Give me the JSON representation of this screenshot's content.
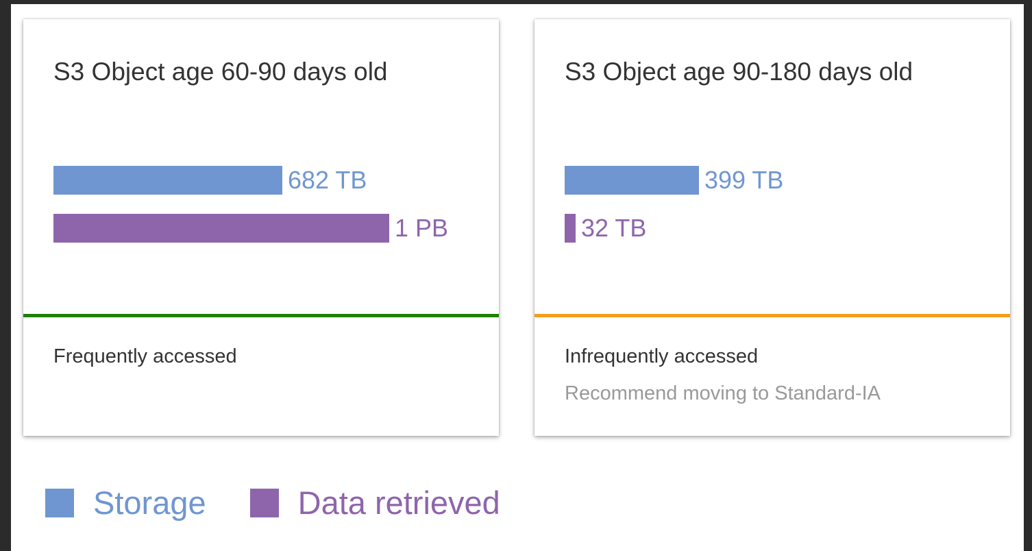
{
  "colors": {
    "storage": "#6f96d1",
    "retrieved": "#8e65ab",
    "frequent": "#1d8102",
    "infrequent": "#f59e1b"
  },
  "legend": {
    "storage_label": "Storage",
    "retrieved_label": "Data retrieved"
  },
  "cards": [
    {
      "title": "S3 Object age 60-90 days old",
      "status": "Frequently accessed",
      "recommendation": "",
      "status_color": "frequent"
    },
    {
      "title": "S3 Object age 90-180 days old",
      "status": "Infrequently accessed",
      "recommendation": "Recommend moving to Standard-IA",
      "status_color": "infrequent"
    }
  ],
  "chart_data": [
    {
      "type": "bar",
      "orientation": "horizontal",
      "title": "S3 Object age 60-90 days old",
      "categories": [
        "Storage",
        "Data retrieved"
      ],
      "values_tb": [
        682,
        1000
      ],
      "value_labels": [
        "682 TB",
        "1 PB"
      ],
      "scale_max_tb": 1000
    },
    {
      "type": "bar",
      "orientation": "horizontal",
      "title": "S3 Object age 90-180 days old",
      "categories": [
        "Storage",
        "Data retrieved"
      ],
      "values_tb": [
        399,
        32
      ],
      "value_labels": [
        "399 TB",
        "32 TB"
      ],
      "scale_max_tb": 1000
    }
  ]
}
